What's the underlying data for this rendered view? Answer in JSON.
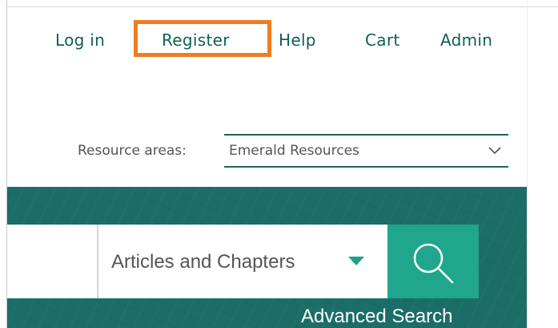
{
  "topnav": {
    "login": "Log in",
    "register": "Register",
    "help": "Help",
    "cart": "Cart",
    "admin": "Admin"
  },
  "resource_areas": {
    "label": "Resource areas:",
    "selected": "Emerald Resources"
  },
  "search": {
    "input_value": "",
    "scope_selected": "Articles and Chapters",
    "button_icon": "search-icon",
    "advanced_link": "Advanced Search"
  },
  "colors": {
    "brand_teal": "#1b6d67",
    "search_button": "#1fa68d",
    "caret": "#1aa187",
    "link": "#0f5f59",
    "highlight": "#f07d22"
  }
}
